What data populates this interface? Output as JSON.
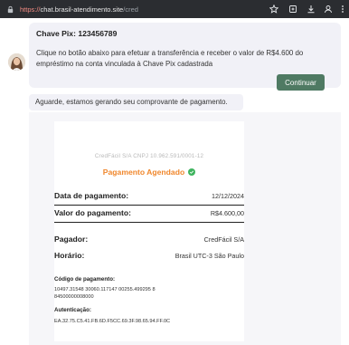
{
  "browser": {
    "url_scheme": "https://",
    "url_host": "chat.brasil-atendimento.site",
    "url_path": "/cred"
  },
  "chat": {
    "pix_title": "Chave Pix: 123456789",
    "pix_message": "Clique no botão abaixo para efetuar a transferência e receber o valor de R$4.600 do empréstimo na conta vinculada à Chave Pix cadastrada",
    "continue_label": "Continuar",
    "wait_message": "Aguarde, estamos gerando seu comprovante de pagamento."
  },
  "receipt": {
    "company_line": "CredFácil S/A CNPJ 10.962.591/0001-12",
    "status": "Pagamento Agendado",
    "date_label": "Data de pagamento:",
    "date_value": "12/12/2024",
    "amount_label": "Valor do pagamento:",
    "amount_value": "R$4.600,00",
    "payer_label": "Pagador:",
    "payer_value": "CredFácil S/A",
    "time_label": "Horário:",
    "time_value": "Brasil UTC-3 São Paulo",
    "code_label": "Código de pagamento:",
    "code_value": "10497.31548 30060.117147 00255.499295 8 84500000008000",
    "auth_label": "Autenticação:",
    "auth_value": "EA.32.75.C5.41.FB.6D.F5CC.69.3F.98.65.94.FF.0C"
  },
  "colors": {
    "accent_button": "#4f7a63",
    "status_orange": "#f0872c",
    "status_green": "#3fb45f"
  },
  "icons": [
    "lock-icon",
    "star-icon",
    "extension-icon",
    "download-icon",
    "profile-icon",
    "menu-icon",
    "check-icon"
  ]
}
